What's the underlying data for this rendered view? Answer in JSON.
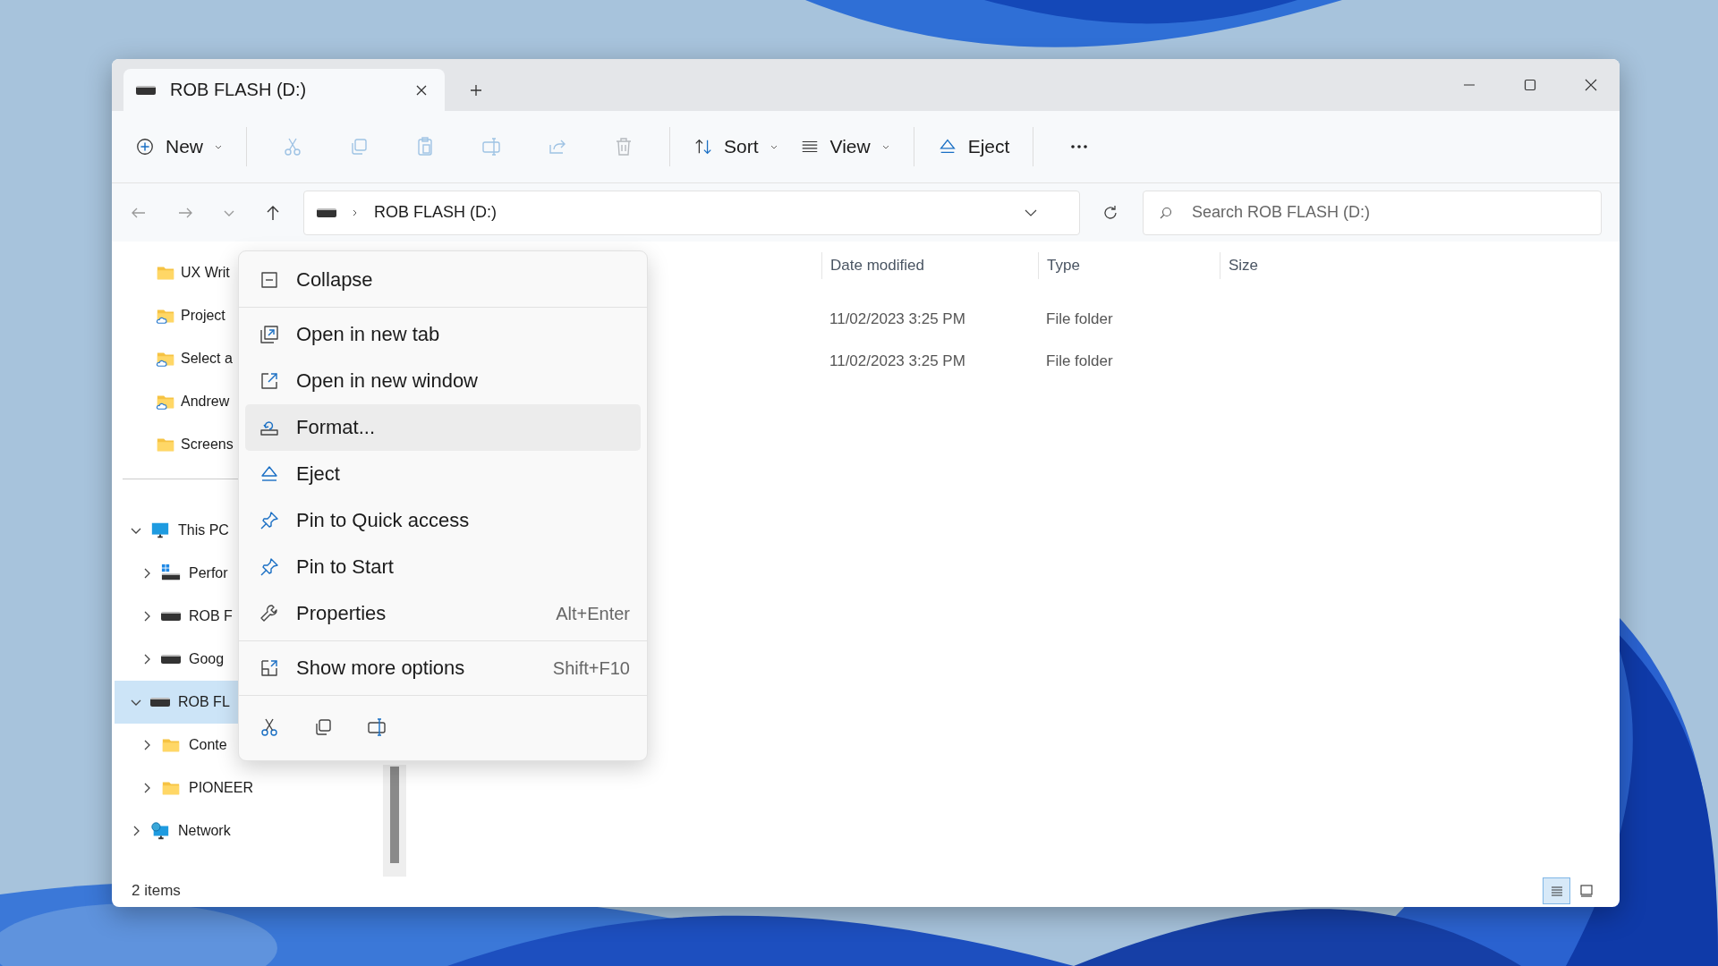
{
  "window": {
    "tab_title": "ROB FLASH (D:)"
  },
  "toolbar": {
    "new_label": "New",
    "actions_disabled": true,
    "sort_label": "Sort",
    "view_label": "View",
    "eject_label": "Eject"
  },
  "address_bar": {
    "path": "ROB FLASH (D:)"
  },
  "search": {
    "placeholder": "Search ROB FLASH (D:)"
  },
  "sidebar": {
    "quick_access": [
      {
        "label": "UX Writ",
        "kind": "folder"
      },
      {
        "label": "Project",
        "kind": "cloud-folder"
      },
      {
        "label": "Select a",
        "kind": "cloud-folder"
      },
      {
        "label": "Andrew",
        "kind": "cloud-folder"
      },
      {
        "label": "Screens",
        "kind": "folder"
      }
    ],
    "tree": [
      {
        "label": "This PC",
        "kind": "pc",
        "expanded": true,
        "selected": false,
        "children": [
          {
            "label": "Perfor",
            "kind": "system-drive",
            "expanded": false,
            "selected": false
          },
          {
            "label": "ROB F",
            "kind": "drive",
            "expanded": false,
            "selected": false
          },
          {
            "label": "Goog",
            "kind": "drive",
            "expanded": false,
            "selected": false
          }
        ]
      },
      {
        "label": "ROB FL",
        "kind": "drive",
        "expanded": true,
        "selected": true,
        "children": [
          {
            "label": "Conte",
            "kind": "folder",
            "expanded": false,
            "selected": false
          },
          {
            "label": "PIONEER",
            "kind": "folder",
            "expanded": false,
            "selected": false
          }
        ]
      },
      {
        "label": "Network",
        "kind": "network",
        "expanded": false,
        "selected": false
      }
    ]
  },
  "file_list": {
    "columns": [
      "Date modified",
      "Type",
      "Size"
    ],
    "rows": [
      {
        "date_modified": "11/02/2023 3:25 PM",
        "type": "File folder"
      },
      {
        "date_modified": "11/02/2023 3:25 PM",
        "type": "File folder"
      }
    ]
  },
  "context_menu": {
    "groups": [
      [
        {
          "label": "Collapse",
          "highlighted": false
        }
      ],
      [
        {
          "label": "Open in new tab",
          "highlighted": false
        },
        {
          "label": "Open in new window",
          "highlighted": false
        },
        {
          "label": "Format...",
          "highlighted": true
        },
        {
          "label": "Eject",
          "highlighted": false
        },
        {
          "label": "Pin to Quick access",
          "highlighted": false
        },
        {
          "label": "Pin to Start",
          "highlighted": false
        },
        {
          "label": "Properties",
          "shortcut": "Alt+Enter",
          "highlighted": false
        }
      ],
      [
        {
          "label": "Show more options",
          "shortcut": "Shift+F10",
          "highlighted": false
        }
      ]
    ]
  },
  "status_bar": {
    "item_count": "2 items",
    "views": [
      {
        "selected": true
      },
      {
        "selected": false
      }
    ]
  }
}
